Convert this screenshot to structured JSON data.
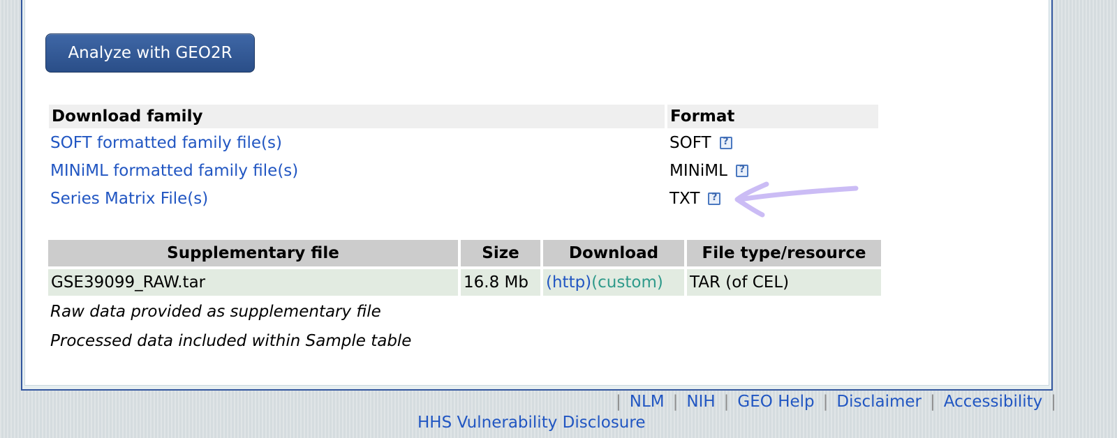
{
  "analyze_button": {
    "label": "Analyze with GEO2R"
  },
  "download_family": {
    "header": "Download family",
    "format_header": "Format",
    "rows": [
      {
        "label": "SOFT formatted family file(s)",
        "format": "SOFT"
      },
      {
        "label": "MINiML formatted family file(s)",
        "format": "MINiML"
      },
      {
        "label": "Series Matrix File(s)",
        "format": "TXT"
      }
    ]
  },
  "supplementary": {
    "headers": [
      "Supplementary file",
      "Size",
      "Download",
      "File type/resource"
    ],
    "rows": [
      {
        "file": "GSE39099_RAW.tar",
        "size": "16.8 Mb",
        "http": "(http)",
        "custom": "(custom)",
        "type": "TAR (of CEL)"
      }
    ],
    "notes": [
      "Raw data provided as supplementary file",
      "Processed data included within Sample table"
    ]
  },
  "footer": {
    "links": [
      "NLM",
      "NIH",
      "GEO Help",
      "Disclaimer",
      "Accessibility"
    ],
    "separator": "|",
    "hhs": "HHS Vulnerability Disclosure"
  },
  "help_icon_glyph": "?",
  "colors": {
    "link": "#2156c2",
    "custom_link": "#2e9a8a",
    "button": "#2f538f",
    "annotation_arrow": "#cbbcf5"
  }
}
